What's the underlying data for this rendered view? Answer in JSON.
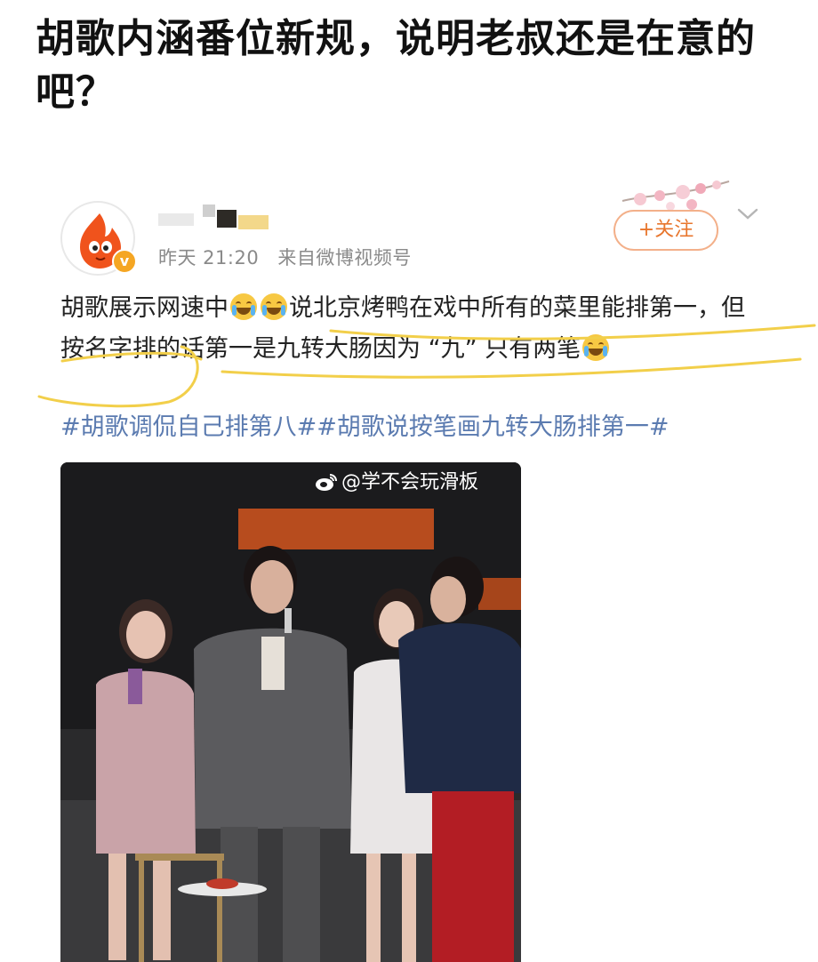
{
  "headline": "胡歌内涵番位新规，说明老叔还是在意的吧？",
  "post": {
    "time": "昨天 21:20",
    "source": "来自微博视频号",
    "follow_label": "+关注",
    "text_part1": "胡歌展示网速中",
    "text_part2": "说北京烤鸭在戏中所有的菜里能排第一，但按名字排的话第一是九转大肠因为 “九” 只有两笔",
    "hashtags": "#胡歌调侃自己排第八##胡歌说按笔画九转大肠排第一#"
  },
  "media": {
    "watermark": "@学不会玩滑板"
  },
  "icons": {
    "avatar": "flame-mascot-avatar",
    "verified": "verified-badge-icon",
    "chevron": "chevron-down-icon",
    "emoji": "laughing-crying-emoji",
    "weibo": "weibo-logo-icon"
  },
  "colors": {
    "follow_border": "#f3b08a",
    "follow_text": "#e8762d",
    "hashtag": "#5b7bb0",
    "highlight": "#f2cf4a",
    "verified": "#f5a623"
  }
}
